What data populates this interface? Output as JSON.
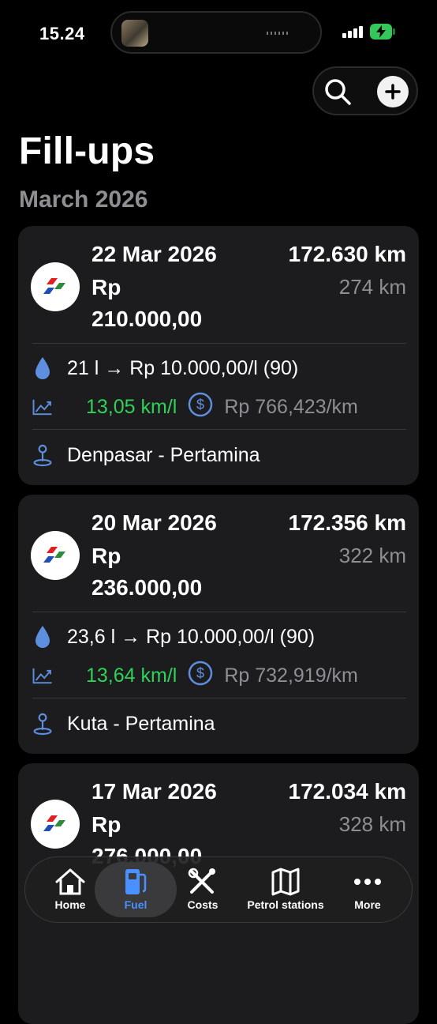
{
  "status_bar": {
    "time": "15.24"
  },
  "header": {
    "title": "Fill-ups",
    "month": "March 2026"
  },
  "colors": {
    "background": "#000000",
    "card": "#1c1c1e",
    "efficiency_good": "#30d158",
    "muted": "#8e8e93",
    "icon_blue": "#5e8ede",
    "active_tab": "#4a90ff"
  },
  "fillups": [
    {
      "date": "22 Mar 2026",
      "odometer": "172.630 km",
      "currency": "Rp",
      "amount": "210.000,00",
      "distance": "274 km",
      "volume_price": "21 l → Rp 10.000,00/l (90)",
      "efficiency": "13,05 km/l",
      "cost_per_km": "Rp 766,423/km",
      "station": "Denpasar - Pertamina"
    },
    {
      "date": "20 Mar 2026",
      "odometer": "172.356 km",
      "currency": "Rp",
      "amount": "236.000,00",
      "distance": "322 km",
      "volume_price": "23,6 l → Rp 10.000,00/l (90)",
      "efficiency": "13,64 km/l",
      "cost_per_km": "Rp 732,919/km",
      "station": "Kuta - Pertamina"
    },
    {
      "date": "17 Mar 2026",
      "odometer": "172.034 km",
      "currency": "Rp",
      "amount": "276.000,00",
      "distance": "328 km"
    }
  ],
  "tabs": [
    {
      "label": "Home",
      "icon": "house-icon"
    },
    {
      "label": "Fuel",
      "icon": "fuel-pump-icon",
      "active": true
    },
    {
      "label": "Costs",
      "icon": "wrench-screwdriver-icon"
    },
    {
      "label": "Petrol stations",
      "icon": "map-icon"
    },
    {
      "label": "More",
      "icon": "ellipsis-icon"
    }
  ]
}
